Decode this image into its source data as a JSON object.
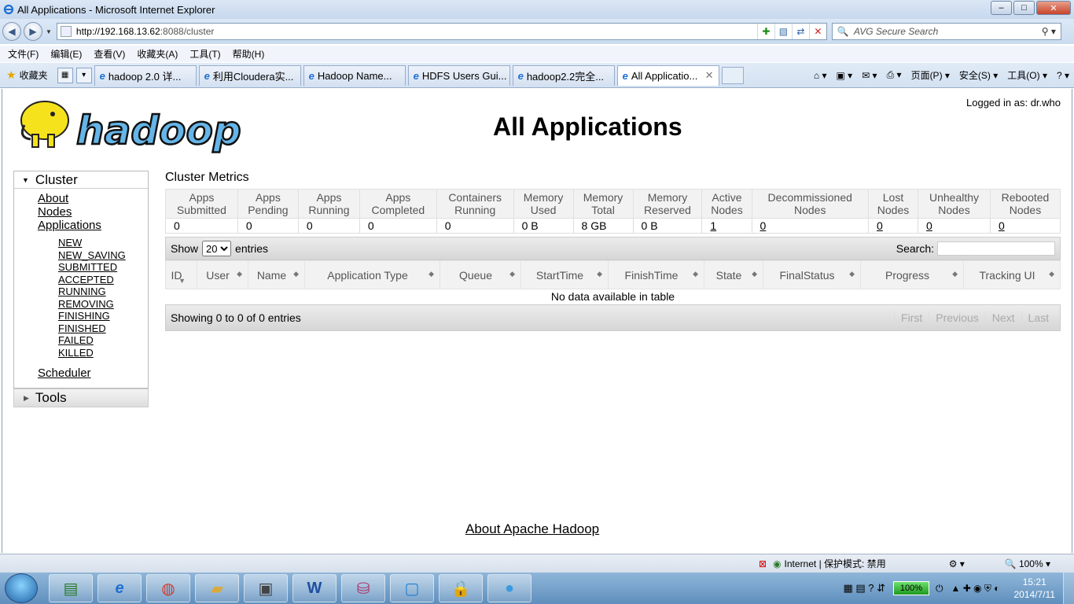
{
  "window": {
    "title": "All Applications - Microsoft Internet Explorer",
    "min": "–",
    "max": "□",
    "close": "✕"
  },
  "address": {
    "url_host": "http://192.168.13.62",
    "url_rest": ":8088/cluster",
    "search_placeholder": "AVG Secure Search"
  },
  "menu": [
    "文件(F)",
    "编辑(E)",
    "查看(V)",
    "收藏夹(A)",
    "工具(T)",
    "帮助(H)"
  ],
  "favorites_label": "收藏夹",
  "tabs": [
    {
      "label": "hadoop 2.0 详..."
    },
    {
      "label": "利用Cloudera实..."
    },
    {
      "label": "Hadoop Name..."
    },
    {
      "label": "HDFS Users Gui..."
    },
    {
      "label": "hadoop2.2完全..."
    },
    {
      "label": "All Applicatio..."
    }
  ],
  "commandbar": {
    "page": "页面(P) ▾",
    "safety": "安全(S) ▾",
    "tools": "工具(O) ▾",
    "help": "? ▾"
  },
  "page": {
    "logged_in": "Logged in as: dr.who",
    "logo_text": "hadoop",
    "title": "All Applications",
    "nav": {
      "cluster_label": "Cluster",
      "links": [
        "About",
        "Nodes",
        "Applications"
      ],
      "app_states": [
        "NEW",
        "NEW_SAVING",
        "SUBMITTED",
        "ACCEPTED",
        "RUNNING",
        "REMOVING",
        "FINISHING",
        "FINISHED",
        "FAILED",
        "KILLED"
      ],
      "scheduler": "Scheduler",
      "tools_label": "Tools"
    },
    "metrics": {
      "title": "Cluster Metrics",
      "headers": [
        [
          "Apps",
          "Submitted"
        ],
        [
          "Apps",
          "Pending"
        ],
        [
          "Apps",
          "Running"
        ],
        [
          "Apps",
          "Completed"
        ],
        [
          "Containers",
          "Running"
        ],
        [
          "Memory",
          "Used"
        ],
        [
          "Memory",
          "Total"
        ],
        [
          "Memory",
          "Reserved"
        ],
        [
          "Active",
          "Nodes"
        ],
        [
          "Decommissioned",
          "Nodes"
        ],
        [
          "Lost",
          "Nodes"
        ],
        [
          "Unhealthy",
          "Nodes"
        ],
        [
          "Rebooted",
          "Nodes"
        ]
      ],
      "values": [
        "0",
        "0",
        "0",
        "0",
        "0",
        "0 B",
        "8 GB",
        "0 B",
        "1",
        "0",
        "0",
        "0",
        "0"
      ]
    },
    "table": {
      "show_label": "Show",
      "page_size": "20",
      "entries_label": "entries",
      "search_label": "Search:",
      "columns": [
        "ID",
        "User",
        "Name",
        "Application Type",
        "Queue",
        "StartTime",
        "FinishTime",
        "State",
        "FinalStatus",
        "Progress",
        "Tracking UI"
      ],
      "empty_message": "No data available in table",
      "info": "Showing 0 to 0 of 0 entries",
      "pager": [
        "First",
        "Previous",
        "Next",
        "Last"
      ]
    },
    "footer_link": "About Apache Hadoop"
  },
  "statusbar": {
    "zone": "Internet | 保护模式: 禁用",
    "zoom": "100%"
  },
  "taskbar": {
    "battery": "100%",
    "time": "15:21",
    "date": "2014/7/11"
  }
}
